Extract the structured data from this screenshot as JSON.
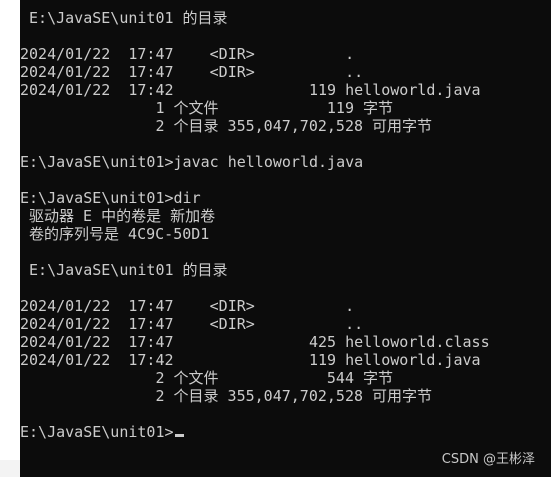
{
  "colors": {
    "background": "#0c0c0c",
    "text": "#cccccc",
    "watermark": "#c8c8c8"
  },
  "console": {
    "lines": [
      " E:\\JavaSE\\unit01 的目录",
      "",
      "2024/01/22  17:47    <DIR>          .",
      "2024/01/22  17:47    <DIR>          ..",
      "2024/01/22  17:42               119 helloworld.java",
      "               1 个文件            119 字节",
      "               2 个目录 355,047,702,528 可用字节",
      "",
      "E:\\JavaSE\\unit01>javac helloworld.java",
      "",
      "E:\\JavaSE\\unit01>dir",
      " 驱动器 E 中的卷是 新加卷",
      " 卷的序列号是 4C9C-50D1",
      "",
      " E:\\JavaSE\\unit01 的目录",
      "",
      "2024/01/22  17:47    <DIR>          .",
      "2024/01/22  17:47    <DIR>          ..",
      "2024/01/22  17:47               425 helloworld.class",
      "2024/01/22  17:42               119 helloworld.java",
      "               2 个文件            544 字节",
      "               2 个目录 355,047,702,528 可用字节",
      "",
      "E:\\JavaSE\\unit01>"
    ]
  },
  "watermark": "CSDN @王彬泽"
}
